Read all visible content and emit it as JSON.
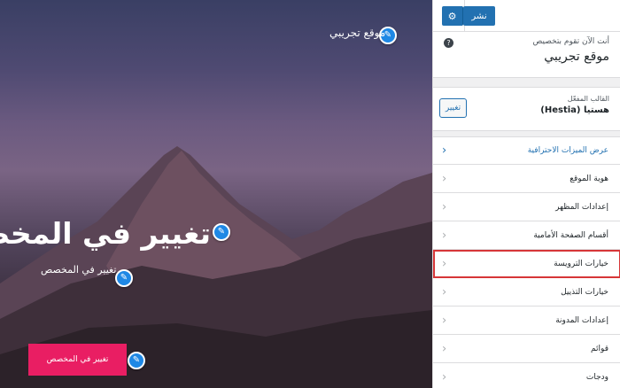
{
  "preview": {
    "site_title": "موقع تجريبي",
    "hero_title": "تغيير في المخصص",
    "hero_subtitle": "تغيير في المخصص",
    "hero_button": "تغيير في المخصص"
  },
  "sidebar": {
    "close_icon": "✕",
    "publish_label": "نشر",
    "settings_icon": "⚙",
    "info_small": "أنت الآن تقوم بتخصيص",
    "site_name": "موقع تجريبي",
    "theme_small": "القالب المفعّل",
    "theme_name": "هستيا (Hestia)",
    "change_label": "تغيير",
    "items": [
      {
        "label": "عرض الميزات الاحترافية"
      },
      {
        "label": "هوية الموقع"
      },
      {
        "label": "إعدادات المظهر"
      },
      {
        "label": "أقسام الصفحة الأمامية"
      },
      {
        "label": "خيارات الترويسة"
      },
      {
        "label": "خيارات التذييل"
      },
      {
        "label": "إعدادات المدونة"
      },
      {
        "label": "قوائم"
      },
      {
        "label": "ودجات"
      }
    ]
  },
  "colors": {
    "accent": "#2271b1",
    "hero_button": "#e91e63",
    "highlight": "#d63638",
    "edit_dot": "#1e88e5"
  }
}
